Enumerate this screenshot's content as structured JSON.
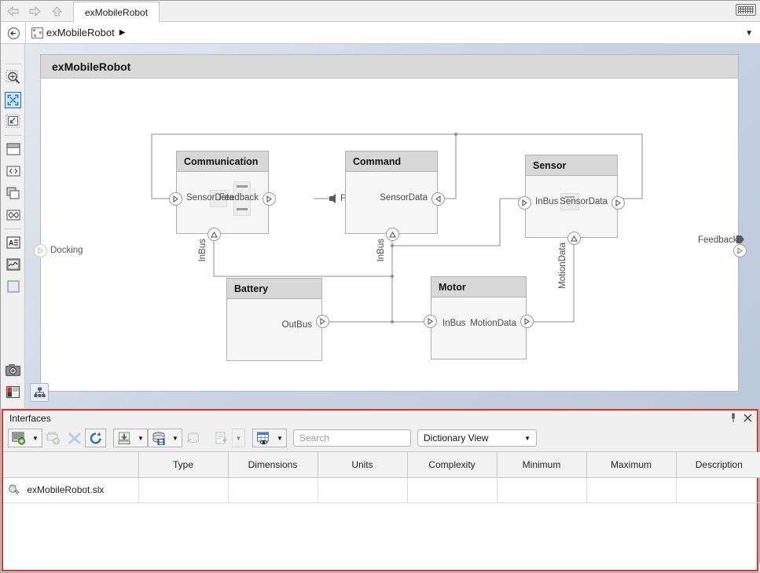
{
  "window": {
    "tab_label": "exMobileRobot",
    "keyboard_icon": "keyboard-icon",
    "nav_back_icon": "back-arrow-icon",
    "nav_forward_icon": "forward-arrow-icon",
    "nav_up_icon": "up-arrow-icon"
  },
  "breadcrumb": {
    "model_icon": "model-icon",
    "label": "exMobileRobot",
    "caret": "▶",
    "dropdown_icon": "chevron-down-icon"
  },
  "rail": {
    "items": [
      {
        "name": "back-navigate-icon"
      },
      {
        "name": "zoom-in-icon"
      },
      {
        "name": "fit-to-view-icon",
        "selected": true
      },
      {
        "name": "zoom-region-icon"
      },
      {
        "name": "component-icon"
      },
      {
        "name": "port-icon"
      },
      {
        "name": "reference-component-icon"
      },
      {
        "name": "variant-component-icon"
      },
      {
        "name": "annotation-icon"
      },
      {
        "name": "stateflow-icon"
      },
      {
        "name": "area-icon"
      },
      {
        "name": "camera-icon"
      },
      {
        "name": "layout-icon"
      },
      {
        "name": "more-icon"
      }
    ]
  },
  "canvas": {
    "system_title": "exMobileRobot",
    "hierarchy_button_icon": "hierarchy-icon",
    "external_ports": [
      {
        "name": "docking-port",
        "label": "Docking",
        "side": "left"
      },
      {
        "name": "feedback-port",
        "label": "Feedback",
        "side": "right"
      }
    ],
    "components": [
      {
        "name": "communication-component",
        "title": "Communication",
        "ports": [
          {
            "label": "SensorData",
            "dir": "in",
            "side": "left"
          },
          {
            "label": "Feedback",
            "dir": "out",
            "side": "right"
          },
          {
            "label": "InBus",
            "dir": "in",
            "side": "bottom"
          }
        ]
      },
      {
        "name": "command-component",
        "title": "Command",
        "ports": [
          {
            "label": "SensorData",
            "dir": "in",
            "side": "right"
          },
          {
            "label": "InBus",
            "dir": "in",
            "side": "bottom"
          }
        ]
      },
      {
        "name": "sensor-component",
        "title": "Sensor",
        "ports": [
          {
            "label": "InBus",
            "dir": "in",
            "side": "left"
          },
          {
            "label": "SensorData",
            "dir": "out",
            "side": "right"
          },
          {
            "label": "MotionData",
            "dir": "in",
            "side": "bottom"
          }
        ]
      },
      {
        "name": "battery-component",
        "title": "Battery",
        "ports": [
          {
            "label": "OutBus",
            "dir": "out",
            "side": "right"
          }
        ]
      },
      {
        "name": "motor-component",
        "title": "Motor",
        "ports": [
          {
            "label": "InBus",
            "dir": "in",
            "side": "left"
          },
          {
            "label": "MotionData",
            "dir": "out",
            "side": "right"
          }
        ]
      }
    ],
    "port_labels": {
      "communication_in": "SensorData",
      "communication_out": "Feedback",
      "communication_bottom": "InBus",
      "communication_feedback_external": "Feedback",
      "command_right": "SensorData",
      "command_bottom": "InBus",
      "sensor_left": "InBus",
      "sensor_right": "SensorData",
      "sensor_bottom": "MotionData",
      "battery_right": "OutBus",
      "motor_left": "InBus",
      "motor_right": "MotionData",
      "docking": "Docking",
      "feedback_external": "Feedback"
    }
  },
  "interfaces": {
    "title": "Interfaces",
    "pin_icon": "pin-icon",
    "close_icon": "close-icon",
    "toolbar": [
      {
        "name": "new-interface-button",
        "icon": "new-interface-icon",
        "has_arrow": true,
        "enabled": true
      },
      {
        "name": "new-element-button",
        "icon": "new-element-icon",
        "has_arrow": false,
        "enabled": false
      },
      {
        "name": "delete-button",
        "icon": "delete-x-icon",
        "has_arrow": false,
        "enabled": false
      },
      {
        "name": "refresh-button",
        "icon": "refresh-icon",
        "has_arrow": false,
        "enabled": true
      },
      {
        "name": "import-button",
        "icon": "import-down-icon",
        "has_arrow": true,
        "enabled": true
      },
      {
        "name": "save-dictionary-button",
        "icon": "save-database-icon",
        "has_arrow": true,
        "enabled": true
      },
      {
        "name": "link-dictionary-button",
        "icon": "link-database-icon",
        "has_arrow": false,
        "enabled": false
      },
      {
        "name": "report-button",
        "icon": "report-down-icon",
        "has_arrow": true,
        "enabled": false
      },
      {
        "name": "view-options-button",
        "icon": "table-eye-icon",
        "has_arrow": true,
        "enabled": true
      }
    ],
    "search": {
      "placeholder": "Search",
      "value": "",
      "icon": "search-icon"
    },
    "view_select": {
      "value": "Dictionary View",
      "icon": "chevron-down-icon"
    },
    "table": {
      "columns": [
        "",
        "Type",
        "Dimensions",
        "Units",
        "Complexity",
        "Minimum",
        "Maximum",
        "Description"
      ],
      "rows": [
        {
          "icon": "slx-file-icon",
          "cells": [
            "exMobileRobot.slx",
            "",
            "",
            "",
            "",
            "",
            "",
            ""
          ]
        }
      ]
    }
  },
  "colors": {
    "accent_red": "#ee2b22",
    "selection_blue": "#1e6fba",
    "canvas_bg": "#c7d2e0",
    "block_header": "#d8d8d8",
    "block_body": "#f6f6f6"
  }
}
